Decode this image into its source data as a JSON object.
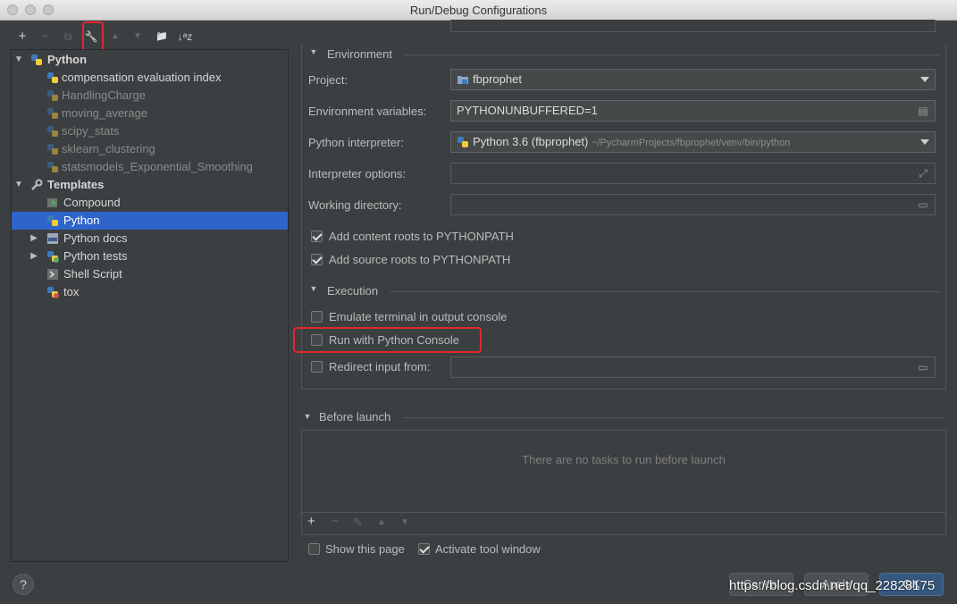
{
  "window": {
    "title": "Run/Debug Configurations"
  },
  "toolbar": {
    "add": "+",
    "remove": "−",
    "copy": "⧉",
    "edit_defaults": "🔧",
    "move_up": "▲",
    "move_down": "▼",
    "folder": "📁",
    "sort": "↓ᵃz"
  },
  "tree": {
    "python_group": "Python",
    "python_items": [
      "compensation evaluation index",
      "HandlingCharge",
      "moving_average",
      "scipy_stats",
      "sklearn_clustering",
      "statsmodels_Exponential_Smoothing"
    ],
    "templates_group": "Templates",
    "template_items": [
      "Compound",
      "Python",
      "Python docs",
      "Python tests",
      "Shell Script",
      "tox"
    ]
  },
  "environment": {
    "header": "Environment",
    "project_label": "Project:",
    "project_value": "fbprophet",
    "env_vars_label": "Environment variables:",
    "env_vars_value": "PYTHONUNBUFFERED=1",
    "interpreter_label": "Python interpreter:",
    "interpreter_value": "Python 3.6 (fbprophet)",
    "interpreter_path": "~/PycharmProjects/fbprophet/venv/bin/python",
    "interp_options_label": "Interpreter options:",
    "working_dir_label": "Working directory:",
    "content_roots_label": "Add content roots to PYTHONPATH",
    "source_roots_label": "Add source roots to PYTHONPATH"
  },
  "execution": {
    "header": "Execution",
    "emulate_terminal_label": "Emulate terminal in output console",
    "run_console_label": "Run with Python Console",
    "redirect_input_label": "Redirect input from:"
  },
  "before_launch": {
    "header": "Before launch",
    "empty_text": "There are no tasks to run before launch",
    "add": "+",
    "remove": "−",
    "edit": "✎",
    "up": "▲",
    "down": "▼"
  },
  "footer": {
    "show_page_label": "Show this page",
    "activate_window_label": "Activate tool window",
    "help": "?",
    "cancel": "Cancel",
    "apply": "Apply",
    "ok": "OK",
    "watermark": "https://blog.csdn.net/qq_22828175"
  },
  "colors": {
    "selection": "#2f65ca",
    "highlight": "#e3262e",
    "background": "#3c3f41"
  }
}
